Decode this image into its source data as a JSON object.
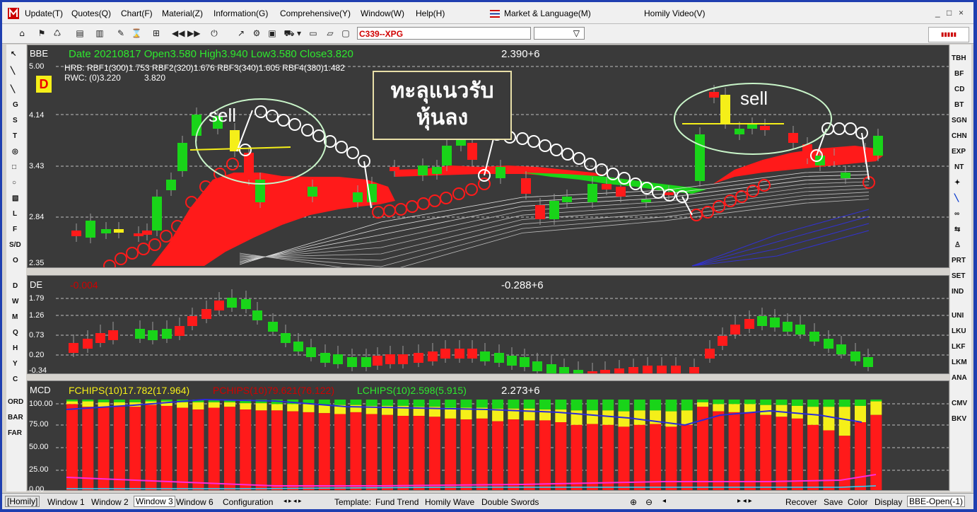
{
  "menu": [
    "Update(T)",
    "Quotes(Q)",
    "Chart(F)",
    "Material(Z)",
    "Information(G)",
    "Comprehensive(Y)",
    "Window(W)",
    "Help(H)",
    "Market & Language(M)",
    "Homily Video(V)"
  ],
  "window_controls": [
    "_",
    "□",
    "×"
  ],
  "symbol": "C339--XPG",
  "left_tools": [
    "G",
    "S",
    "T",
    "L",
    "F",
    "S/D",
    "O",
    "D",
    "W",
    "M",
    "Q",
    "H",
    "Y",
    "C",
    "ORD",
    "BAR",
    "FAR"
  ],
  "right_tools": [
    "TBH",
    "BF",
    "CD",
    "BT",
    "SGN",
    "CHN",
    "EXP",
    "NT",
    "PRT",
    "SET",
    "IND",
    "UNI",
    "LKU",
    "LKF",
    "LKM",
    "ANA",
    "CMV",
    "BKV"
  ],
  "panel1": {
    "name": "BBE",
    "info": "Date 20210817  Open3.580  High3.940  Low3.580  Close3.820",
    "value": "2.390+6",
    "line2": "HRB: RBF1(300)1.753  RBF2(320)1.676  RBF3(340)1.605  RBF4(380)1.482",
    "line3a": "RWC: (0)3.220",
    "line3b": "3.820",
    "badge": "D",
    "axis": [
      "5.00",
      "4.14",
      "3.43",
      "2.84",
      "2.35"
    ],
    "annotation_thai_1": "ทะลุแนวรับ",
    "annotation_thai_2": "หุ้นลง",
    "sell_1": "sell",
    "sell_2": "sell"
  },
  "panel2": {
    "name": "DE",
    "value_red": "-0.004",
    "value": "-0.288+6",
    "axis": [
      "1.79",
      "1.26",
      "0.73",
      "0.20",
      "-0.34"
    ]
  },
  "panel3": {
    "name": "MCD",
    "f": "FCHIPS(10)17.782(17.964)",
    "p": "PCHIPS(10)79.621(76.122)",
    "l": "LCHIPS(10)2.598(5.915)",
    "value": "2.273+6",
    "axis": [
      "100.00",
      "75.00",
      "50.00",
      "25.00",
      "0.00"
    ]
  },
  "status": {
    "homily": "[Homily]",
    "windows": [
      "Window 1",
      "Window 2",
      "Window 3",
      "Window 6"
    ],
    "config": "Configuration",
    "template_label": "Template:",
    "templates": [
      "Fund Trend",
      "Homily Wave",
      "Double Swords"
    ],
    "right": [
      "Recover",
      "Save",
      "Color",
      "Display"
    ],
    "mode": "BBE-Open(-1)"
  },
  "colors": {
    "up": "#19d419",
    "down": "#ff1a1a",
    "yellow": "#f5ef19",
    "bg": "#3a3a3a",
    "green_text": "#2ee82e"
  }
}
